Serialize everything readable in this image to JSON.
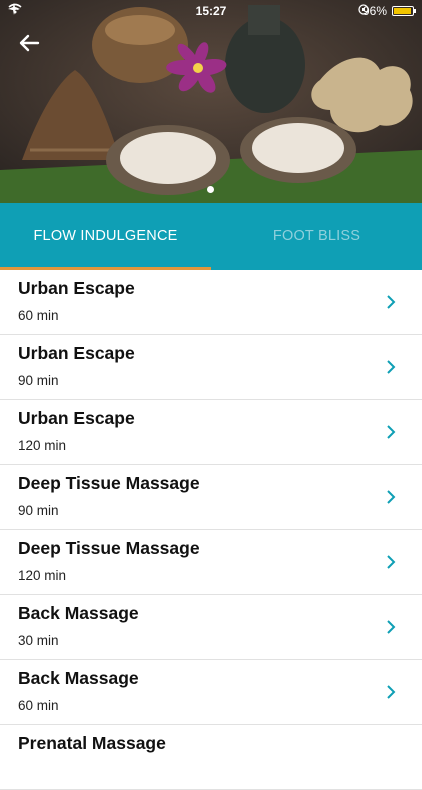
{
  "status_bar": {
    "time": "15:27",
    "battery": "96%",
    "battery_level": 0.96
  },
  "hero": {
    "page_count": 1,
    "current_page": 1
  },
  "tabs": [
    {
      "label": "FLOW INDULGENCE",
      "active": true
    },
    {
      "label": "FOOT BLISS",
      "active": false
    }
  ],
  "items": [
    {
      "title": "Urban Escape",
      "duration": "60 min"
    },
    {
      "title": "Urban Escape",
      "duration": "90 min"
    },
    {
      "title": "Urban Escape",
      "duration": "120 min"
    },
    {
      "title": "Deep Tissue Massage",
      "duration": "90 min"
    },
    {
      "title": "Deep Tissue Massage",
      "duration": "120 min"
    },
    {
      "title": "Back Massage",
      "duration": "30 min"
    },
    {
      "title": "Back Massage",
      "duration": "60 min"
    },
    {
      "title": "Prenatal Massage",
      "duration": ""
    }
  ],
  "colors": {
    "tab_bar": "#0f9fb5",
    "tab_indicator": "#e3963a",
    "chevron": "#0f9fb5"
  }
}
